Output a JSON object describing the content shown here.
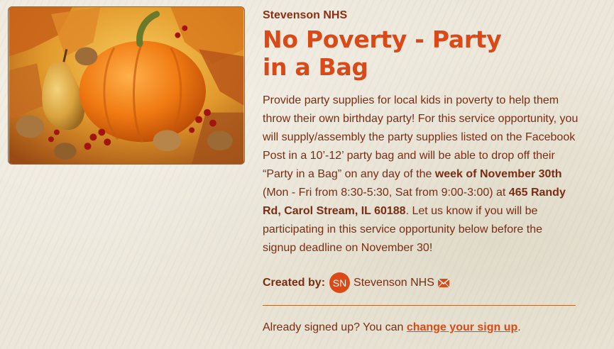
{
  "org": {
    "name": "Stevenson NHS"
  },
  "event": {
    "title": "No Poverty - Party in a Bag",
    "description": {
      "part1": "Provide party supplies for local kids in poverty to help them throw their own birthday party! For this service opportunity, you will supply/assembly the party supplies listed on the Facebook Post in a 10’-12’ party bag and will be able to drop off their “Party in a Bag” on any day of the ",
      "bold1": "week of November 30th",
      "part2": " (Mon - Fri from 8:30-5:30, Sat from 9:00-3:00) at ",
      "bold2": "465 Randy Rd, Carol Stream, IL 60188",
      "part3": ". Let us know if you will be participating in this service opportunity below before the signup deadline on November 30!"
    }
  },
  "creator": {
    "label": "Created by:",
    "initials": "SN",
    "name": "Stevenson NHS",
    "icon": "mail-icon"
  },
  "signup": {
    "prefix": "Already signed up? You can ",
    "link_label": "change your sign up",
    "suffix": "."
  },
  "colors": {
    "title": "#d94a18",
    "text": "#7a2d12",
    "accent": "#d94a18",
    "background": "#ece7da"
  }
}
